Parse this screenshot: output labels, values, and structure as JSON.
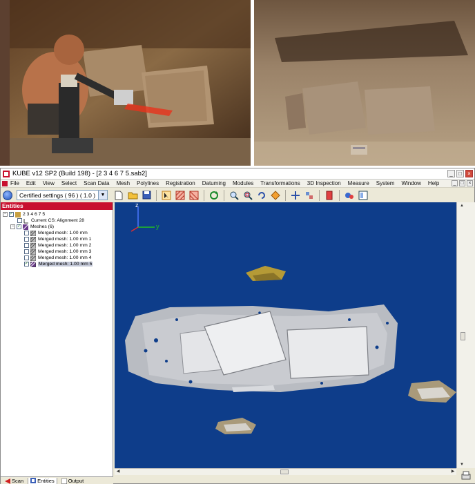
{
  "window": {
    "title": "KUBE v12 SP2 (Build 198) - [2 3 4 6 7 5.sab2]",
    "minimize": "_",
    "maximize": "□",
    "close": "×"
  },
  "menus": [
    "File",
    "Edit",
    "View",
    "Select",
    "Scan Data",
    "Mesh",
    "Polylines",
    "Registration",
    "Datuming",
    "Modules",
    "Transformations",
    "3D Inspection",
    "Measure",
    "System",
    "Window",
    "Help"
  ],
  "toolbar": {
    "settings_value": "Certified settings ( 96 ) ( 1.0 )",
    "icons": [
      "new-file-icon",
      "open-folder-icon",
      "save-icon",
      "select-tool-icon",
      "hatch-select-icon",
      "hatch-deselect-icon",
      "refresh-icon",
      "zoom-fit-icon",
      "zoom-window-icon",
      "rotate-view-icon",
      "orient-icon",
      "move-icon",
      "align-icon",
      "section-icon",
      "render-icon",
      "view-frame-icon"
    ]
  },
  "panel": {
    "header": "Entities",
    "tree": [
      {
        "label": "2 3 4 6 7 5",
        "level": 0,
        "expander": "−",
        "checked": true,
        "icon": "project-icon"
      },
      {
        "label": "Current CS: Alignment 28",
        "level": 1,
        "expander": "",
        "checked": false,
        "icon": "coordinate-system-icon"
      },
      {
        "label": "Meshes (6)",
        "level": 1,
        "expander": "−",
        "checked": true,
        "icon": "meshes-folder-icon"
      },
      {
        "label": "Merged mesh: 1.00 mm",
        "level": 2,
        "expander": "",
        "checked": false,
        "icon": "mesh-icon"
      },
      {
        "label": "Merged mesh: 1.00 mm 1",
        "level": 2,
        "expander": "",
        "checked": false,
        "icon": "mesh-icon"
      },
      {
        "label": "Merged mesh: 1.00 mm 2",
        "level": 2,
        "expander": "",
        "checked": false,
        "icon": "mesh-icon"
      },
      {
        "label": "Merged mesh: 1.00 mm 3",
        "level": 2,
        "expander": "",
        "checked": false,
        "icon": "mesh-icon"
      },
      {
        "label": "Merged mesh: 1.00 mm 4",
        "level": 2,
        "expander": "",
        "checked": false,
        "icon": "mesh-icon"
      },
      {
        "label": "Merged mesh: 1.00 mm 5",
        "level": 2,
        "expander": "",
        "checked": true,
        "icon": "mesh-icon",
        "selected": true
      }
    ],
    "tabs": [
      {
        "label": "Scan",
        "icon": "scan-icon",
        "active": false
      },
      {
        "label": "Entities",
        "icon": "entities-icon",
        "active": true
      },
      {
        "label": "Output",
        "icon": "output-icon",
        "active": false
      }
    ]
  },
  "viewport": {
    "axis_z": "z",
    "axis_y": "y",
    "background": "#0e3d8a"
  },
  "colors": {
    "accent_red": "#c8102e",
    "mesh_gray": "#c9c9c9",
    "mesh_gold": "#b59a36"
  }
}
